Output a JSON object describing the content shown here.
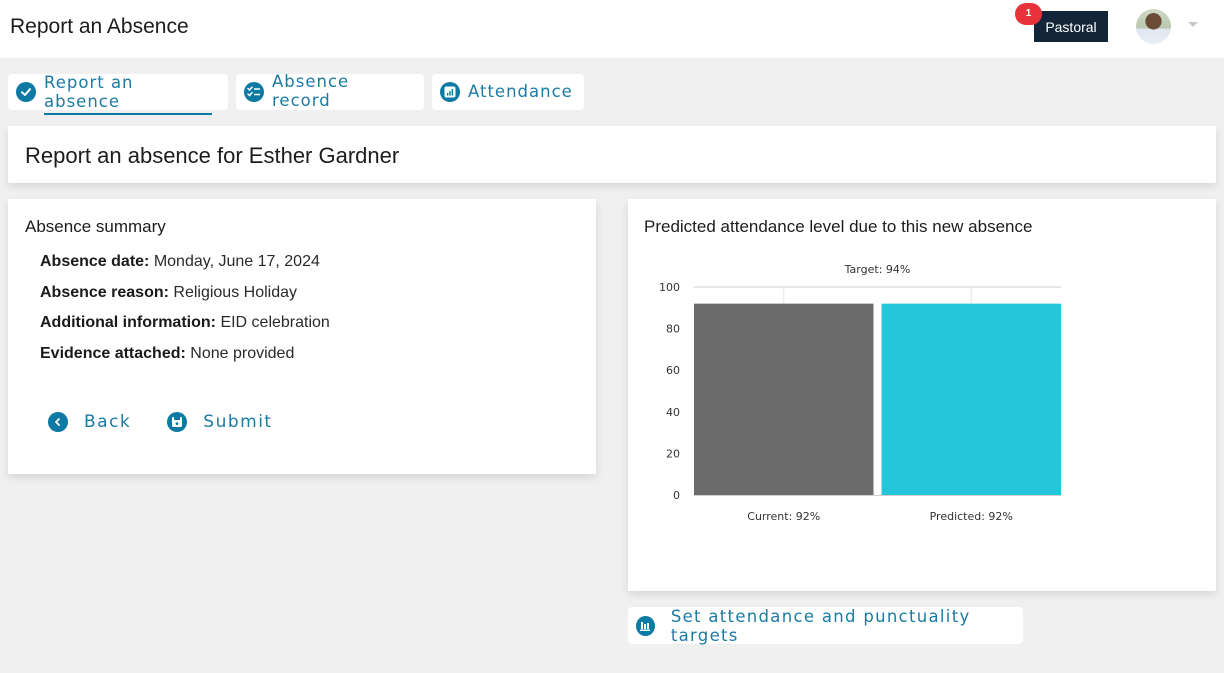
{
  "header": {
    "title": "Report an Absence",
    "role_button": "Pastoral",
    "notification_count": "1",
    "avatar_alt": "User avatar"
  },
  "tabs": [
    {
      "label": "Report an absence",
      "icon": "check-circle-icon",
      "active": true
    },
    {
      "label": "Absence record",
      "icon": "checklist-icon",
      "active": false
    },
    {
      "label": "Attendance",
      "icon": "bar-chart-icon",
      "active": false
    }
  ],
  "page": {
    "heading": "Report an absence for Esther Gardner"
  },
  "summary": {
    "title": "Absence summary",
    "rows": [
      {
        "label": "Absence date:",
        "value": "Monday, June 17, 2024"
      },
      {
        "label": "Absence reason:",
        "value": "Religious Holiday"
      },
      {
        "label": "Additional information:",
        "value": "EID celebration"
      },
      {
        "label": "Evidence attached:",
        "value": "None provided"
      }
    ],
    "back_label": "Back",
    "submit_label": "Submit"
  },
  "prediction": {
    "title": "Predicted attendance level due to this new absence",
    "targets_button": "Set attendance and punctuality targets"
  },
  "colors": {
    "accent": "#0d7aa3",
    "current_bar": "#6b6b6b",
    "predicted_bar": "#26c6da",
    "pastoral_bg": "#132538",
    "badge": "#e8323a"
  },
  "chart_data": {
    "type": "bar",
    "title": "Predicted attendance level due to this new absence",
    "categories": [
      "Current: 92%",
      "Predicted: 92%"
    ],
    "values": [
      92,
      92
    ],
    "bar_colors": [
      "#6b6b6b",
      "#26c6da"
    ],
    "target": {
      "label": "Target: 94%",
      "value": 94
    },
    "xlabel": "",
    "ylabel": "",
    "ylim": [
      0,
      100
    ],
    "yticks": [
      0,
      20,
      40,
      60,
      80,
      100
    ],
    "grid": false,
    "legend": "none"
  }
}
